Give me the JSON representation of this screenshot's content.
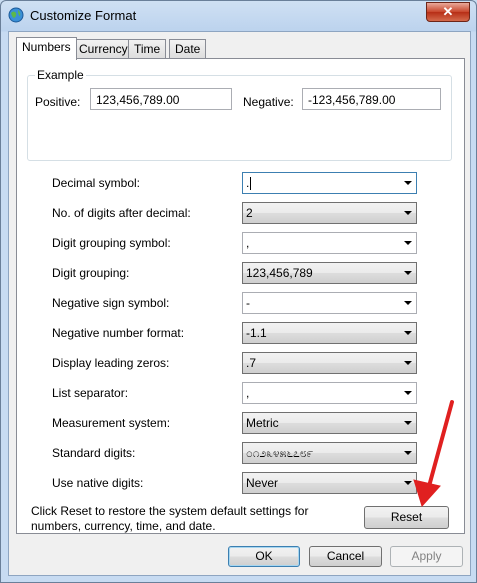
{
  "window": {
    "title": "Customize Format",
    "close_glyph": "✕"
  },
  "tabs": [
    {
      "label": "Numbers",
      "active": true
    },
    {
      "label": "Currency",
      "active": false
    },
    {
      "label": "Time",
      "active": false
    },
    {
      "label": "Date",
      "active": false
    }
  ],
  "example": {
    "legend": "Example",
    "positive_label": "Positive:",
    "positive_value": "123,456,789.00",
    "negative_label": "Negative:",
    "negative_value": "-123,456,789.00"
  },
  "settings": [
    {
      "label": "Decimal symbol:",
      "value": ".",
      "style": "edit"
    },
    {
      "label": "No. of digits after decimal:",
      "value": "2",
      "style": "list"
    },
    {
      "label": "Digit grouping symbol:",
      "value": ",",
      "style": "edit"
    },
    {
      "label": "Digit grouping:",
      "value": "123,456,789",
      "style": "list"
    },
    {
      "label": "Negative sign symbol:",
      "value": "-",
      "style": "edit"
    },
    {
      "label": "Negative number format:",
      "value": "-1.1",
      "style": "list"
    },
    {
      "label": "Display leading zeros:",
      "value": ".7",
      "style": "list"
    },
    {
      "label": "List separator:",
      "value": ",",
      "style": "edit"
    },
    {
      "label": "Measurement system:",
      "value": "Metric",
      "style": "list"
    },
    {
      "label": "Standard digits:",
      "value": "೦೧೨೩೪೫೬೭೮೯",
      "style": "list"
    },
    {
      "label": "Use native digits:",
      "value": "Never",
      "style": "list"
    }
  ],
  "info": {
    "text": "Click Reset to restore the system default settings for numbers, currency, time, and date."
  },
  "buttons": {
    "reset": "Reset",
    "ok": "OK",
    "cancel": "Cancel",
    "apply": "Apply"
  },
  "colors": {
    "annotation_arrow": "#e02020"
  }
}
